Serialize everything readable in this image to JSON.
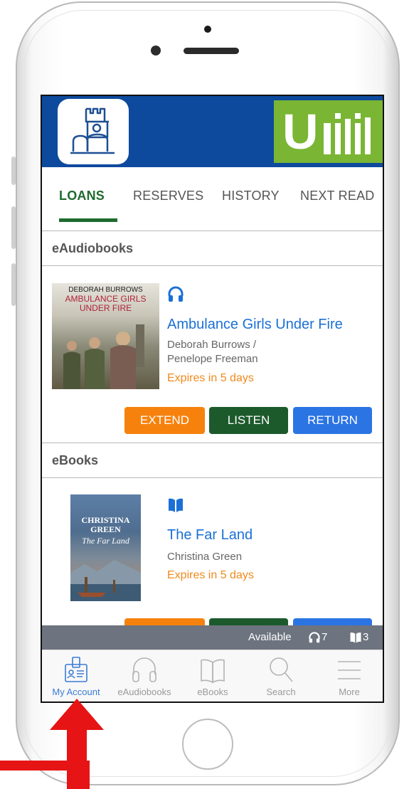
{
  "tabs": [
    {
      "label": "LOANS",
      "active": true
    },
    {
      "label": "RESERVES",
      "active": false
    },
    {
      "label": "HISTORY",
      "active": false
    },
    {
      "label": "NEXT READ",
      "active": false
    }
  ],
  "sections": {
    "audiobooks": {
      "title": "eAudiobooks",
      "item": {
        "cover_author": "DEBORAH BURROWS",
        "cover_title": "AMBULANCE GIRLS UNDER FIRE",
        "icon": "headphones-icon",
        "title": "Ambulance Girls Under Fire",
        "authors": "Deborah Burrows / Penelope Freeman",
        "expiry": "Expires in 5 days"
      },
      "buttons": {
        "extend": "EXTEND",
        "primary": "LISTEN",
        "return": "RETURN"
      }
    },
    "ebooks": {
      "title": "eBooks",
      "item": {
        "cover_author": "CHRISTINA GREEN",
        "cover_title": "The Far Land",
        "icon": "book-icon",
        "title": "The Far Land",
        "authors": "Christina Green",
        "expiry": "Expires in 5 days"
      }
    }
  },
  "available_bar": {
    "label": "Available",
    "audiobooks_count": "7",
    "ebooks_count": "3"
  },
  "nav": [
    {
      "label": "My Account",
      "icon": "account-card-icon",
      "active": true
    },
    {
      "label": "eAudiobooks",
      "icon": "headphones-icon",
      "active": false
    },
    {
      "label": "eBooks",
      "icon": "open-book-icon",
      "active": false
    },
    {
      "label": "Search",
      "icon": "search-icon",
      "active": false
    },
    {
      "label": "More",
      "icon": "menu-icon",
      "active": false
    }
  ],
  "colors": {
    "header_blue": "#0d4a9e",
    "brand_green": "#7ab534",
    "active_tab": "#1e6b2e",
    "link_blue": "#1a70d6",
    "expiry_orange": "#f08a1c",
    "extend_orange": "#f6820d",
    "listen_green": "#1c5a2c",
    "return_blue": "#2b74e3",
    "annotation_red": "#e61414"
  }
}
